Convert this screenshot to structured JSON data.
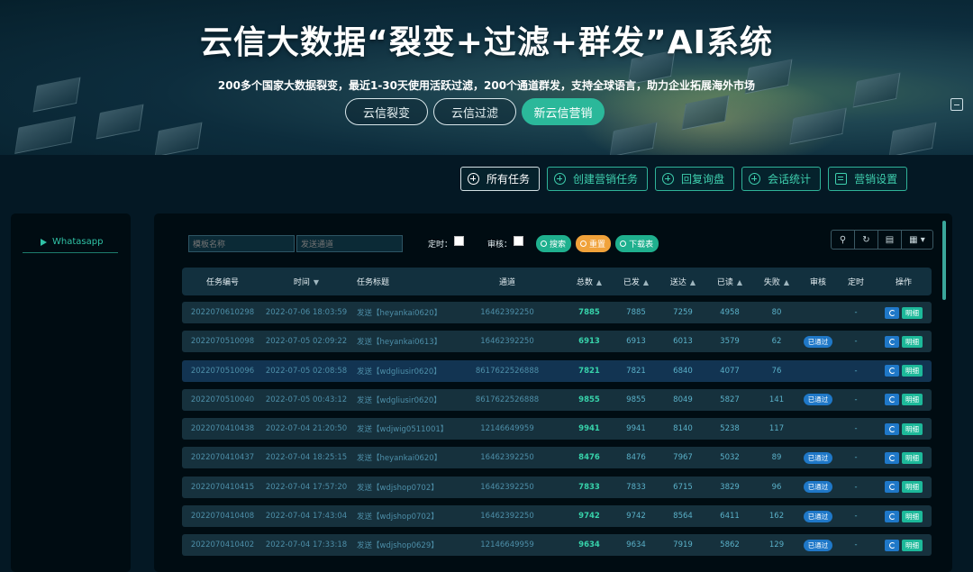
{
  "banner": {
    "title": "云信大数据“裂变+过滤+群发”AI系统",
    "subtitle": "200多个国家大数据裂变，最近1-30天使用活跃过滤，200个通道群发，支持全球语言，助力企业拓展海外市场",
    "tabs": [
      "云信裂变",
      "云信过滤",
      "新云信营销"
    ],
    "active_tab": "新云信营销"
  },
  "toolbar": {
    "all_tasks": "所有任务",
    "create_task": "创建营销任务",
    "reply_inquiry": "回复询盘",
    "session_stats": "会话统计",
    "marketing_settings": "营销设置"
  },
  "sidebar": {
    "items": [
      {
        "label": "Whatasapp"
      }
    ]
  },
  "filters": {
    "template_placeholder": "模板名称",
    "channel_placeholder": "发送通道",
    "timed_label": "定时：",
    "review_label": "审核：",
    "search_btn": "搜索",
    "reset_btn": "重置",
    "download_btn": "下载表"
  },
  "table": {
    "headers": [
      "任务编号",
      "时间",
      "任务标题",
      "通道",
      "总数",
      "已发",
      "送达",
      "已读",
      "失败",
      "审核",
      "定时",
      "操作"
    ],
    "detail_label": "明细",
    "rows": [
      {
        "id": "2022070610298",
        "time": "2022-07-06 18:03:59",
        "title": "发送【heyankai0620】",
        "channel": "16462392250",
        "total": "7885",
        "sent": "7885",
        "delivered": "7259",
        "read": "4958",
        "failed": "80",
        "review": "",
        "timed": "-"
      },
      {
        "id": "2022070510098",
        "time": "2022-07-05 02:09:22",
        "title": "发送【heyankai0613】",
        "channel": "16462392250",
        "total": "6913",
        "sent": "6913",
        "delivered": "6013",
        "read": "3579",
        "failed": "62",
        "review": "已通过",
        "timed": "-"
      },
      {
        "id": "2022070510096",
        "time": "2022-07-05 02:08:58",
        "title": "发送【wdgliusir0620】",
        "channel": "8617622526888",
        "total": "7821",
        "sent": "7821",
        "delivered": "6840",
        "read": "4077",
        "failed": "76",
        "review": "",
        "timed": "-"
      },
      {
        "id": "2022070510040",
        "time": "2022-07-05 00:43:12",
        "title": "发送【wdgliusir0620】",
        "channel": "8617622526888",
        "total": "9855",
        "sent": "9855",
        "delivered": "8049",
        "read": "5827",
        "failed": "141",
        "review": "已通过",
        "timed": "-"
      },
      {
        "id": "2022070410438",
        "time": "2022-07-04 21:20:50",
        "title": "发送【wdjwig0511001】",
        "channel": "12146649959",
        "total": "9941",
        "sent": "9941",
        "delivered": "8140",
        "read": "5238",
        "failed": "117",
        "review": "",
        "timed": "-"
      },
      {
        "id": "2022070410437",
        "time": "2022-07-04 18:25:15",
        "title": "发送【heyankai0620】",
        "channel": "16462392250",
        "total": "8476",
        "sent": "8476",
        "delivered": "7967",
        "read": "5032",
        "failed": "89",
        "review": "已通过",
        "timed": "-"
      },
      {
        "id": "2022070410415",
        "time": "2022-07-04 17:57:20",
        "title": "发送【wdjshop0702】",
        "channel": "16462392250",
        "total": "7833",
        "sent": "7833",
        "delivered": "6715",
        "read": "3829",
        "failed": "96",
        "review": "已通过",
        "timed": "-"
      },
      {
        "id": "2022070410408",
        "time": "2022-07-04 17:43:04",
        "title": "发送【wdjshop0702】",
        "channel": "16462392250",
        "total": "9742",
        "sent": "9742",
        "delivered": "8564",
        "read": "6411",
        "failed": "162",
        "review": "已通过",
        "timed": "-"
      },
      {
        "id": "2022070410402",
        "time": "2022-07-04 17:33:18",
        "title": "发送【wdjshop0629】",
        "channel": "12146649959",
        "total": "9634",
        "sent": "9634",
        "delivered": "7919",
        "read": "5862",
        "failed": "129",
        "review": "已通过",
        "timed": "-"
      }
    ]
  },
  "colors": {
    "accent": "#2bb89a",
    "badge": "#1f78c8",
    "panel_bg": "#000c12"
  }
}
